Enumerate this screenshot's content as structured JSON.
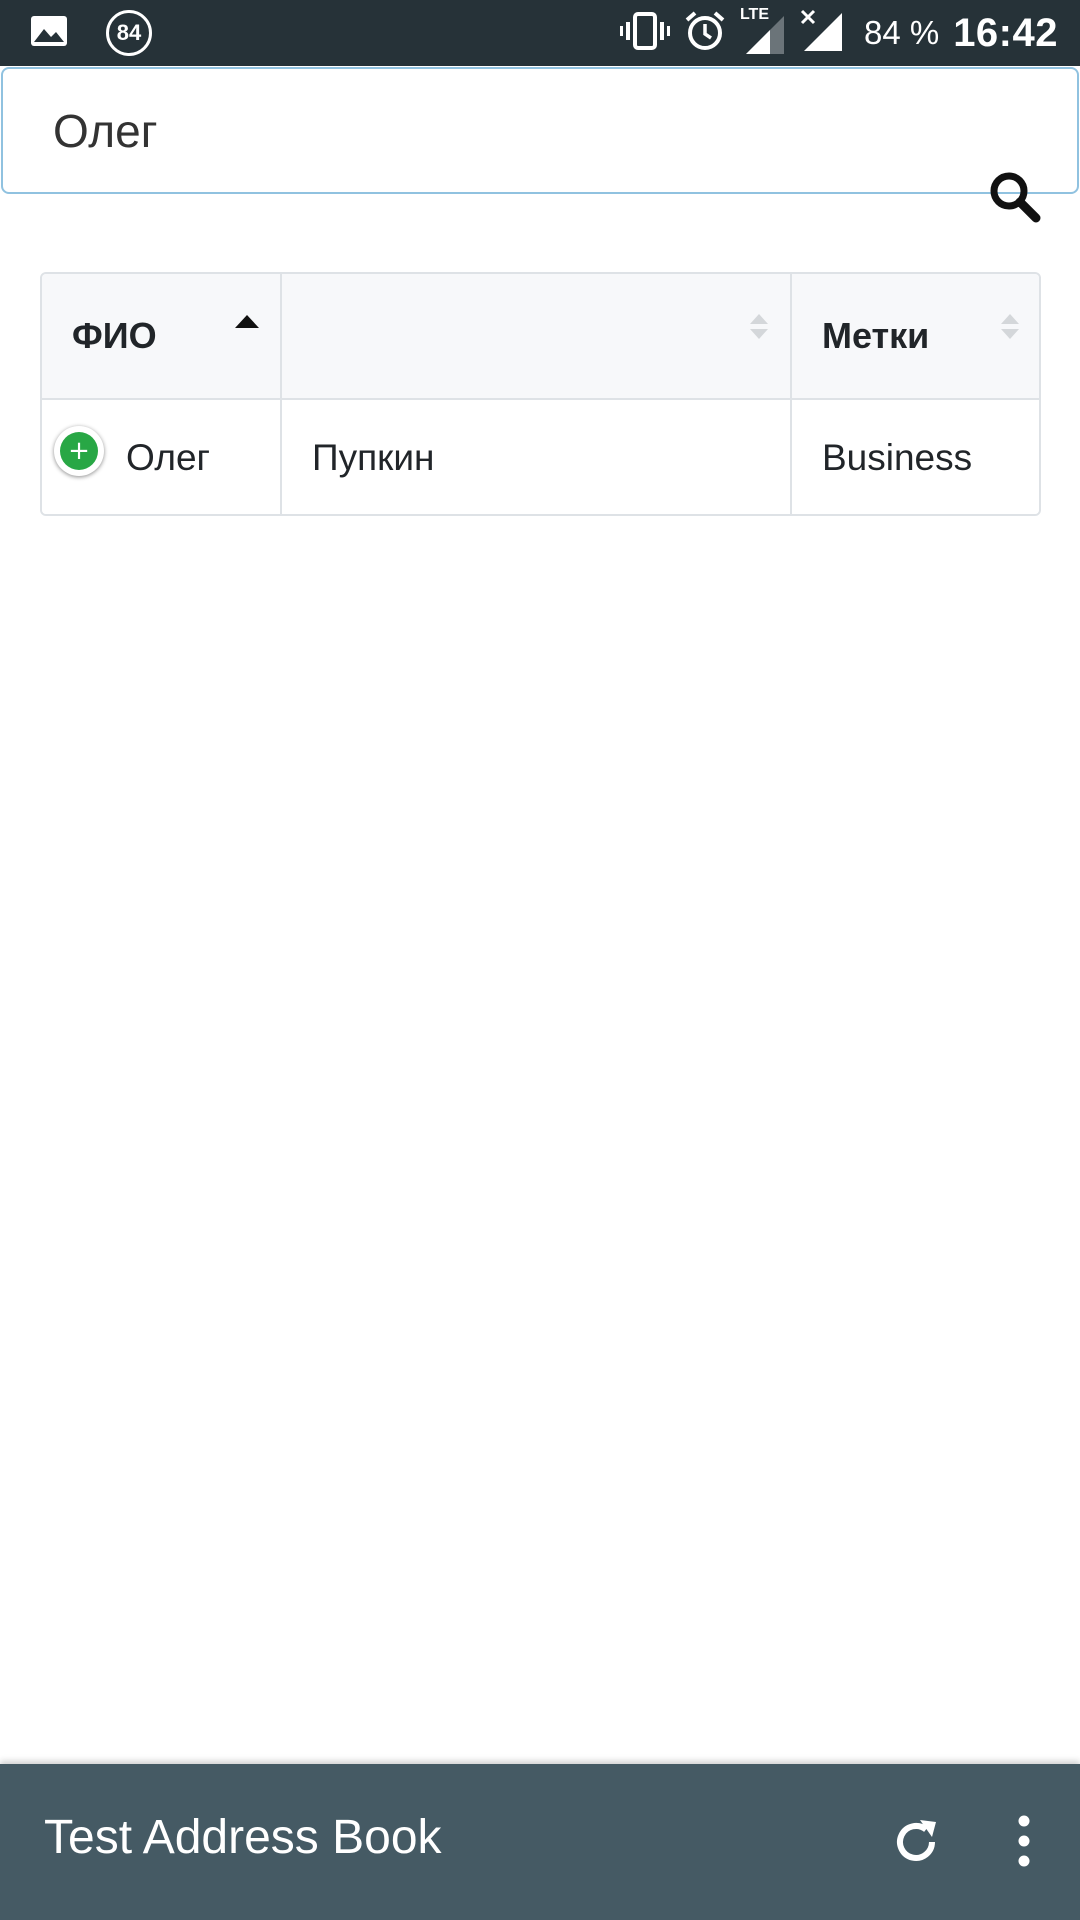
{
  "status_bar": {
    "notification_count": "84",
    "battery": "84 %",
    "time": "16:42",
    "network": "LTE"
  },
  "search": {
    "value": "Олег",
    "placeholder": ""
  },
  "table": {
    "columns": [
      {
        "label": "ФИО",
        "sort": "ascending"
      },
      {
        "label": "",
        "sort": "none"
      },
      {
        "label": "Метки",
        "sort": "none"
      }
    ],
    "rows": [
      {
        "first_name": "Олег",
        "last_name": "Пупкин",
        "tags": "Business"
      }
    ]
  },
  "toolbar": {
    "title": "Test Address Book",
    "icons": [
      "refresh-icon",
      "more-vert-icon"
    ]
  },
  "colors": {
    "status_bar": "#263238",
    "toolbar": "#455a64",
    "expand_button": "#28a745",
    "search_border": "#90c2e0"
  }
}
